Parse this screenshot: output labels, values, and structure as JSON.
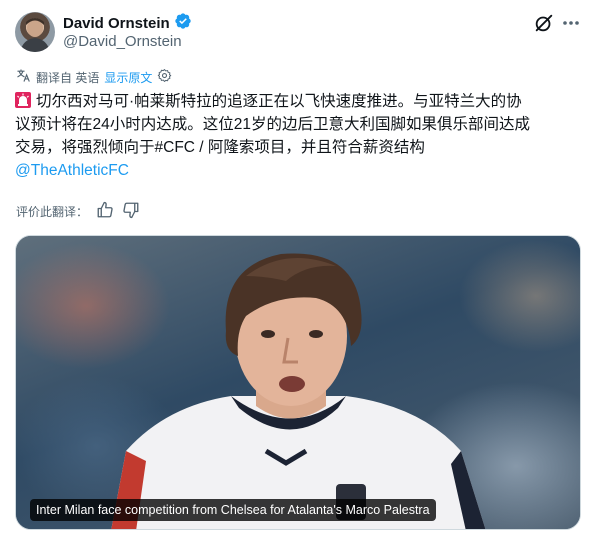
{
  "author": {
    "display_name": "David Ornstein",
    "handle": "@David_Ornstein"
  },
  "translation": {
    "translated_from": "翻译自 英语",
    "show_original": "显示原文"
  },
  "tweet": {
    "line1": "切尔西对马可·帕莱斯特拉的追逐正在以飞快速度推进。与亚特兰大的协",
    "line2": "议预计将在24小时内达成。这位21岁的边后卫意大利国脚如果俱乐部间达成",
    "line3": "交易，将强烈倾向于#CFC / 阿隆索项目，并且符合薪资结构",
    "mention": "@TheAthleticFC"
  },
  "rating": {
    "label": "评价此翻译："
  },
  "media": {
    "caption": "Inter Milan face competition from Chelsea for Atalanta's Marco Palestra"
  },
  "colors": {
    "accent": "#1d9bf0",
    "secondary_text": "#536471",
    "primary_text": "#0f1419"
  },
  "icons": {
    "verified": "verified-badge-icon",
    "grok": "grok-icon",
    "more": "more-icon",
    "translate": "translate-icon",
    "settings": "gear-icon",
    "siren": "siren-icon",
    "thumbs_up": "thumbs-up-icon",
    "thumbs_down": "thumbs-down-icon"
  }
}
